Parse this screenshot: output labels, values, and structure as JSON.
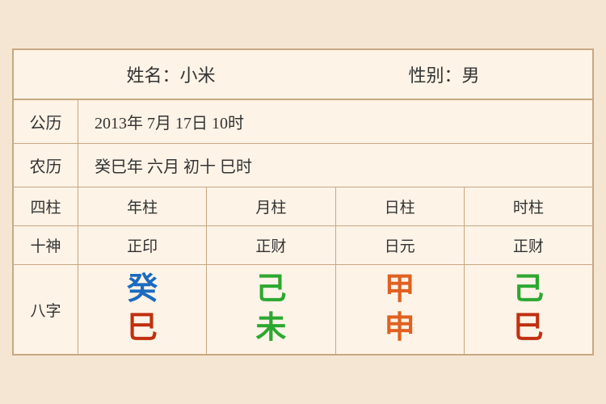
{
  "header": {
    "name_label": "姓名：小米",
    "gender_label": "性别：男"
  },
  "solar": {
    "label": "公历",
    "value": "2013年 7月 17日 10时"
  },
  "lunar": {
    "label": "农历",
    "value": "癸巳年 六月 初十 巳时"
  },
  "columns": {
    "label": "四柱",
    "items": [
      "年柱",
      "月柱",
      "日柱",
      "时柱"
    ]
  },
  "shishen": {
    "label": "十神",
    "items": [
      "正印",
      "正财",
      "日元",
      "正财"
    ]
  },
  "bazi": {
    "label": "八字",
    "columns": [
      {
        "top": "癸",
        "bottom": "巳",
        "top_color": "blue",
        "bottom_color": "red-brown"
      },
      {
        "top": "己",
        "bottom": "未",
        "top_color": "green",
        "bottom_color": "green"
      },
      {
        "top": "甲",
        "bottom": "申",
        "top_color": "orange",
        "bottom_color": "orange"
      },
      {
        "top": "己",
        "bottom": "巳",
        "top_color": "green2",
        "bottom_color": "red-brown"
      }
    ]
  }
}
